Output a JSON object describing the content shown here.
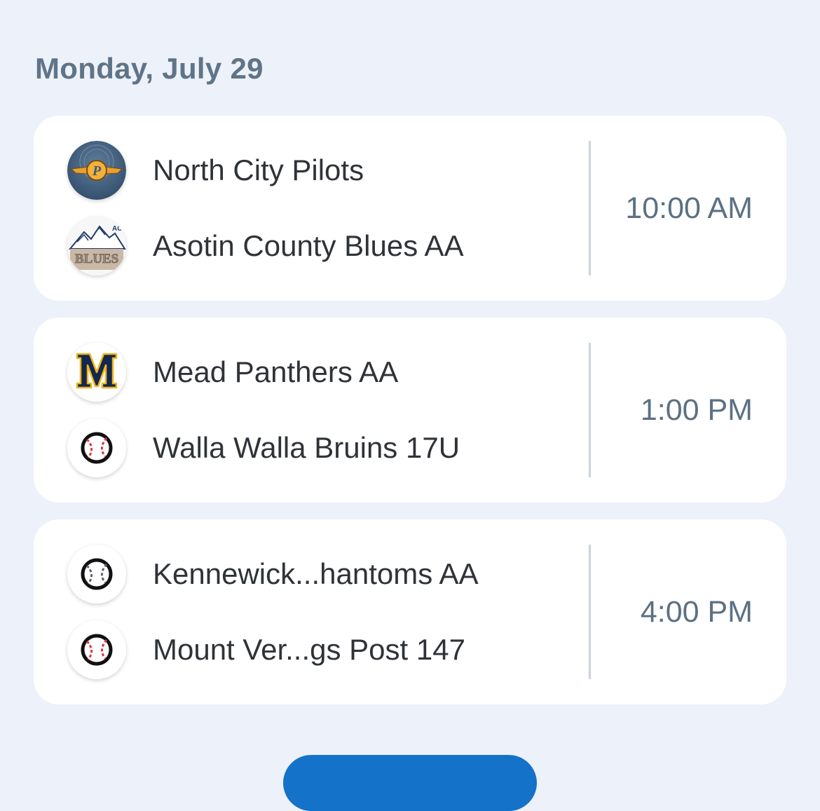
{
  "schedule": {
    "date_label": "Monday, July 29",
    "games": [
      {
        "home": {
          "name": "North City Pilots",
          "logo": "pilots-wings-logo-icon"
        },
        "away": {
          "name": "Asotin County Blues AA",
          "logo": "blues-mountain-logo-icon"
        },
        "time": "10:00 AM"
      },
      {
        "home": {
          "name": "Mead Panthers AA",
          "logo": "mead-m-logo-icon"
        },
        "away": {
          "name": "Walla Walla Bruins 17U",
          "logo": "baseball-red-stitches-icon"
        },
        "time": "1:00 PM"
      },
      {
        "home": {
          "name": "Kennewick...hantoms AA",
          "logo": "baseball-gray-stitches-icon"
        },
        "away": {
          "name": "Mount Ver...gs Post 147",
          "logo": "baseball-red-stitches-icon"
        },
        "time": "4:00 PM"
      }
    ]
  },
  "colors": {
    "background": "#edf1f9",
    "card": "#ffffff",
    "date_text": "#5f7488",
    "team_text": "#2f3338",
    "time_text": "#5b7084",
    "divider": "#c9d3de",
    "accent_button": "#1472c8",
    "baseball_red": "#e0333f",
    "baseball_gray": "#5d6470",
    "mead_navy": "#13284f",
    "mead_gold": "#f0b51c"
  }
}
